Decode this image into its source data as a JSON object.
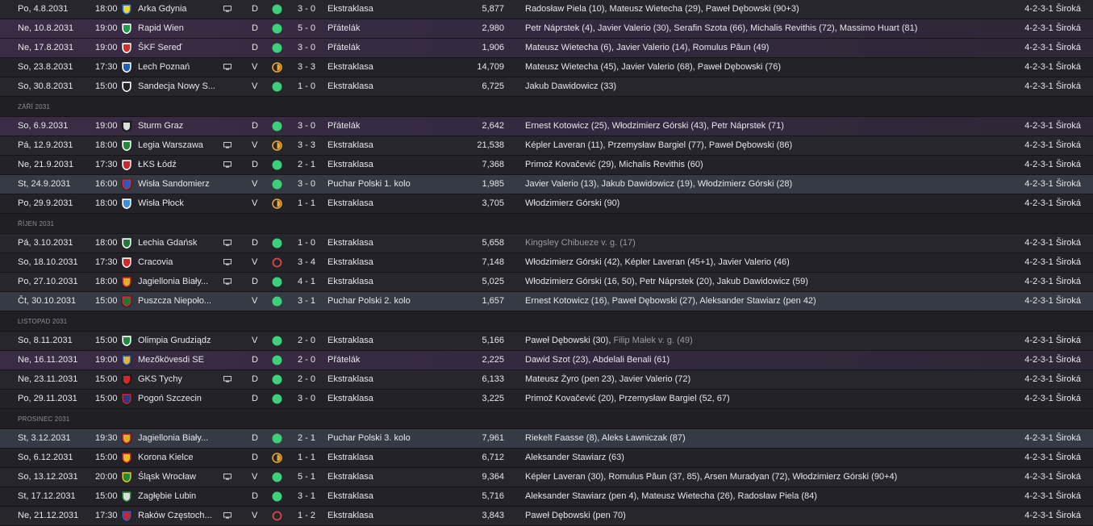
{
  "colors": {
    "win": "#3ecf7a",
    "draw": "#e7a532",
    "loss": "#d8474a",
    "friendly_row": "#3a2c44",
    "cup_row": "#363a45"
  },
  "groups": [
    {
      "month": "",
      "matches": [
        {
          "date": "Po, 4.8.2031",
          "time": "18:00",
          "crest": "arka-gdynia-crest",
          "crest_colors": [
            "#f2d431",
            "#2a6fc9"
          ],
          "opponent": "Arka Gdynia",
          "tv": true,
          "venue": "D",
          "result": "win",
          "score": "3 - 0",
          "competition": "Ekstraklasa",
          "type": "league",
          "attendance": "5,877",
          "scorers": [
            {
              "text": "Radosław Piela (10), Mateusz Wietecha (29), Paweł Dębowski (90+3)",
              "muted": false
            }
          ],
          "formation": "4-2-3-1 Široká"
        },
        {
          "date": "Ne, 10.8.2031",
          "time": "19:00",
          "crest": "rapid-wien-crest",
          "crest_colors": [
            "#1e9e4a",
            "#ffffff"
          ],
          "opponent": "Rapid Wien",
          "tv": false,
          "venue": "D",
          "result": "win",
          "score": "5 - 0",
          "competition": "Přátelák",
          "type": "friendly",
          "attendance": "2,980",
          "scorers": [
            {
              "text": "Petr Náprstek (4), Javier Valerio (30), Serafin Szota (66), Michalis Revithis (72), Massimo Huart (81)",
              "muted": false
            }
          ],
          "formation": "4-2-3-1 Široká"
        },
        {
          "date": "Ne, 17.8.2031",
          "time": "19:00",
          "crest": "skf-sered-crest",
          "crest_colors": [
            "#d22c2c",
            "#ffffff"
          ],
          "opponent": "ŠKF Sereď",
          "tv": false,
          "venue": "D",
          "result": "win",
          "score": "3 - 0",
          "competition": "Přátelák",
          "type": "friendly",
          "attendance": "1,906",
          "scorers": [
            {
              "text": "Mateusz Wietecha (6), Javier Valerio (14), Romulus Păun (49)",
              "muted": false
            }
          ],
          "formation": "4-2-3-1 Široká"
        },
        {
          "date": "So, 23.8.2031",
          "time": "17:30",
          "crest": "lech-poznan-crest",
          "crest_colors": [
            "#1f5fb8",
            "#ffffff"
          ],
          "opponent": "Lech Poznań",
          "tv": true,
          "venue": "V",
          "result": "draw",
          "score": "3 - 3",
          "competition": "Ekstraklasa",
          "type": "league",
          "attendance": "14,709",
          "scorers": [
            {
              "text": "Mateusz Wietecha (45), Javier Valerio (68), Paweł Dębowski (76)",
              "muted": false
            }
          ],
          "formation": "4-2-3-1 Široká"
        },
        {
          "date": "So, 30.8.2031",
          "time": "15:00",
          "crest": "sandecja-crest",
          "crest_colors": [
            "#222222",
            "#ffffff"
          ],
          "opponent": "Sandecja Nowy S...",
          "tv": false,
          "venue": "V",
          "result": "win",
          "score": "1 - 0",
          "competition": "Ekstraklasa",
          "type": "league",
          "attendance": "6,725",
          "scorers": [
            {
              "text": "Jakub Dawidowicz (33)",
              "muted": false
            }
          ],
          "formation": "4-2-3-1 Široká"
        }
      ]
    },
    {
      "month": "ZÁŘÍ 2031",
      "matches": [
        {
          "date": "So, 6.9.2031",
          "time": "19:00",
          "crest": "sturm-graz-crest",
          "crest_colors": [
            "#dddddd",
            "#222222"
          ],
          "opponent": "Sturm Graz",
          "tv": false,
          "venue": "D",
          "result": "win",
          "score": "3 - 0",
          "competition": "Přátelák",
          "type": "friendly",
          "attendance": "2,642",
          "scorers": [
            {
              "text": "Ernest Kotowicz (25), Włodzimierz Górski (43), Petr Náprstek (71)",
              "muted": false
            }
          ],
          "formation": "4-2-3-1 Široká"
        },
        {
          "date": "Pá, 12.9.2031",
          "time": "18:00",
          "crest": "legia-warszawa-crest",
          "crest_colors": [
            "#1d8a3c",
            "#ffffff"
          ],
          "opponent": "Legia Warszawa",
          "tv": true,
          "venue": "V",
          "result": "draw",
          "score": "3 - 3",
          "competition": "Ekstraklasa",
          "type": "league",
          "attendance": "21,538",
          "scorers": [
            {
              "text": "Képler Laveran (11), Przemysław Bargiel (77), Paweł Dębowski (86)",
              "muted": false
            }
          ],
          "formation": "4-2-3-1 Široká"
        },
        {
          "date": "Ne, 21.9.2031",
          "time": "17:30",
          "crest": "lks-lodz-crest",
          "crest_colors": [
            "#c8262b",
            "#ffffff"
          ],
          "opponent": "ŁKS Łódź",
          "tv": true,
          "venue": "D",
          "result": "win",
          "score": "2 - 1",
          "competition": "Ekstraklasa",
          "type": "league",
          "attendance": "7,368",
          "scorers": [
            {
              "text": "Primož Kovačević (29), Michalis Revithis (60)",
              "muted": false
            }
          ],
          "formation": "4-2-3-1 Široká"
        },
        {
          "date": "St, 24.9.2031",
          "time": "16:00",
          "crest": "wisla-sandomierz-crest",
          "crest_colors": [
            "#2a59c4",
            "#d82a2a"
          ],
          "opponent": "Wisła Sandomierz",
          "tv": false,
          "venue": "V",
          "result": "win",
          "score": "3 - 0",
          "competition": "Puchar Polski 1. kolo",
          "type": "cup",
          "attendance": "1,985",
          "scorers": [
            {
              "text": "Javier Valerio (13), Jakub Dawidowicz (19), Włodzimierz Górski (28)",
              "muted": false
            }
          ],
          "formation": "4-2-3-1 Široká"
        },
        {
          "date": "Po, 29.9.2031",
          "time": "18:00",
          "crest": "wisla-plock-crest",
          "crest_colors": [
            "#3b8ee0",
            "#ffffff"
          ],
          "opponent": "Wisła Płock",
          "tv": false,
          "venue": "V",
          "result": "draw",
          "score": "1 - 1",
          "competition": "Ekstraklasa",
          "type": "league",
          "attendance": "3,705",
          "scorers": [
            {
              "text": "Włodzimierz Górski (90)",
              "muted": false
            }
          ],
          "formation": "4-2-3-1 Široká"
        }
      ]
    },
    {
      "month": "ŘÍJEN 2031",
      "matches": [
        {
          "date": "Pá, 3.10.2031",
          "time": "18:00",
          "crest": "lechia-gdansk-crest",
          "crest_colors": [
            "#1f7a3a",
            "#ffffff"
          ],
          "opponent": "Lechia Gdańsk",
          "tv": true,
          "venue": "D",
          "result": "win",
          "score": "1 - 0",
          "competition": "Ekstraklasa",
          "type": "league",
          "attendance": "5,658",
          "scorers": [
            {
              "text": "Kingsley Chibueze v. g. (17)",
              "muted": true
            }
          ],
          "formation": "4-2-3-1 Široká"
        },
        {
          "date": "So, 18.10.2031",
          "time": "17:30",
          "crest": "cracovia-crest",
          "crest_colors": [
            "#d8262b",
            "#ffffff"
          ],
          "opponent": "Cracovia",
          "tv": true,
          "venue": "V",
          "result": "loss",
          "score": "3 - 4",
          "competition": "Ekstraklasa",
          "type": "league",
          "attendance": "7,148",
          "scorers": [
            {
              "text": "Włodzimierz Górski (42), Képler Laveran (45+1), Javier Valerio (46)",
              "muted": false
            }
          ],
          "formation": "4-2-3-1 Široká"
        },
        {
          "date": "Po, 27.10.2031",
          "time": "18:00",
          "crest": "jagiellonia-crest",
          "crest_colors": [
            "#d6b426",
            "#c8262b"
          ],
          "opponent": "Jagiellonia Biały...",
          "tv": true,
          "venue": "D",
          "result": "win",
          "score": "4 - 1",
          "competition": "Ekstraklasa",
          "type": "league",
          "attendance": "5,025",
          "scorers": [
            {
              "text": "Włodzimierz Górski (16, 50), Petr Náprstek (20), Jakub Dawidowicz (59)",
              "muted": false
            }
          ],
          "formation": "4-2-3-1 Široká"
        },
        {
          "date": "Čt, 30.10.2031",
          "time": "15:00",
          "crest": "puszcza-crest",
          "crest_colors": [
            "#1b7d35",
            "#d8262b"
          ],
          "opponent": "Puszcza Niepoło...",
          "tv": false,
          "venue": "V",
          "result": "win",
          "score": "3 - 1",
          "competition": "Puchar Polski 2. kolo",
          "type": "cup",
          "attendance": "1,657",
          "scorers": [
            {
              "text": "Ernest Kotowicz (16), Paweł Dębowski (27), Aleksander Stawiarz (pen 42)",
              "muted": false
            }
          ],
          "formation": "4-2-3-1 Široká"
        }
      ]
    },
    {
      "month": "LISTOPAD 2031",
      "matches": [
        {
          "date": "So, 8.11.2031",
          "time": "15:00",
          "crest": "olimpia-grudziadz-crest",
          "crest_colors": [
            "#1f8a3c",
            "#ffffff"
          ],
          "opponent": "Olimpia Grudziądz",
          "tv": false,
          "venue": "V",
          "result": "win",
          "score": "2 - 0",
          "competition": "Ekstraklasa",
          "type": "league",
          "attendance": "5,166",
          "scorers": [
            {
              "text": "Paweł Dębowski (30), ",
              "muted": false
            },
            {
              "text": "Filip Małek v. g. (49)",
              "muted": true
            }
          ],
          "formation": "4-2-3-1 Široká"
        },
        {
          "date": "Ne, 16.11.2031",
          "time": "19:00",
          "crest": "mezokovesd-crest",
          "crest_colors": [
            "#e3b52a",
            "#2a59c4"
          ],
          "opponent": "Mezőkövesdi SE",
          "tv": false,
          "venue": "D",
          "result": "win",
          "score": "2 - 0",
          "competition": "Přátelák",
          "type": "friendly",
          "attendance": "2,225",
          "scorers": [
            {
              "text": "Dawid Szot (23), Abdelali Benali (61)",
              "muted": false
            }
          ],
          "formation": "4-2-3-1 Široká"
        },
        {
          "date": "Ne, 23.11.2031",
          "time": "15:00",
          "crest": "gks-tychy-crest",
          "crest_colors": [
            "#d8262b",
            "#222222"
          ],
          "opponent": "GKS Tychy",
          "tv": true,
          "venue": "D",
          "result": "win",
          "score": "2 - 0",
          "competition": "Ekstraklasa",
          "type": "league",
          "attendance": "6,133",
          "scorers": [
            {
              "text": "Mateusz Żyro (pen 23), Javier Valerio (72)",
              "muted": false
            }
          ],
          "formation": "4-2-3-1 Široká"
        },
        {
          "date": "Po, 29.11.2031",
          "time": "15:00",
          "crest": "pogon-szczecin-crest",
          "crest_colors": [
            "#1d3f8a",
            "#c8262b"
          ],
          "opponent": "Pogoń Szczecin",
          "tv": false,
          "venue": "D",
          "result": "win",
          "score": "3 - 0",
          "competition": "Ekstraklasa",
          "type": "league",
          "attendance": "3,225",
          "scorers": [
            {
              "text": "Primož Kovačević (20), Przemysław Bargiel (52, 67)",
              "muted": false
            }
          ],
          "formation": "4-2-3-1 Široká"
        }
      ]
    },
    {
      "month": "PROSINEC 2031",
      "matches": [
        {
          "date": "St, 3.12.2031",
          "time": "19:30",
          "crest": "jagiellonia-crest",
          "crest_colors": [
            "#d6b426",
            "#c8262b"
          ],
          "opponent": "Jagiellonia Biały...",
          "tv": false,
          "venue": "D",
          "result": "win",
          "score": "2 - 1",
          "competition": "Puchar Polski 3. kolo",
          "type": "cup",
          "attendance": "7,961",
          "scorers": [
            {
              "text": "Riekelt Faasse (8), Aleks Ławniczak (87)",
              "muted": false
            }
          ],
          "formation": "4-2-3-1 Široká"
        },
        {
          "date": "So, 6.12.2031",
          "time": "15:00",
          "crest": "korona-kielce-crest",
          "crest_colors": [
            "#e3c01f",
            "#c8262b"
          ],
          "opponent": "Korona Kielce",
          "tv": false,
          "venue": "D",
          "result": "draw",
          "score": "1 - 1",
          "competition": "Ekstraklasa",
          "type": "league",
          "attendance": "6,712",
          "scorers": [
            {
              "text": "Aleksander Stawiarz (63)",
              "muted": false
            }
          ],
          "formation": "4-2-3-1 Široká"
        },
        {
          "date": "So, 13.12.2031",
          "time": "20:00",
          "crest": "slask-wroclaw-crest",
          "crest_colors": [
            "#1d8a3c",
            "#e3c01f"
          ],
          "opponent": "Śląsk Wrocław",
          "tv": true,
          "venue": "V",
          "result": "win",
          "score": "5 - 1",
          "competition": "Ekstraklasa",
          "type": "league",
          "attendance": "9,364",
          "scorers": [
            {
              "text": "Képler Laveran (30), Romulus Păun (37, 85), Arsen Muradyan (72), Włodzimierz Górski (90+4)",
              "muted": false
            }
          ],
          "formation": "4-2-3-1 Široká"
        },
        {
          "date": "St, 17.12.2031",
          "time": "15:00",
          "crest": "zaglebie-lubin-crest",
          "crest_colors": [
            "#dddddd",
            "#2a8a3c"
          ],
          "opponent": "Zagłębie Lubin",
          "tv": false,
          "venue": "D",
          "result": "win",
          "score": "3 - 1",
          "competition": "Ekstraklasa",
          "type": "league",
          "attendance": "5,716",
          "scorers": [
            {
              "text": "Aleksander Stawiarz (pen 4), Mateusz Wietecha (26), Radosław Piela (84)",
              "muted": false
            }
          ],
          "formation": "4-2-3-1 Široká"
        },
        {
          "date": "Ne, 21.12.2031",
          "time": "17:30",
          "crest": "rakow-crest",
          "crest_colors": [
            "#c8262b",
            "#2a59c4"
          ],
          "opponent": "Raków Częstoch...",
          "tv": true,
          "venue": "V",
          "result": "loss",
          "score": "1 - 2",
          "competition": "Ekstraklasa",
          "type": "league",
          "attendance": "3,843",
          "scorers": [
            {
              "text": "Paweł Dębowski (pen 70)",
              "muted": false
            }
          ],
          "formation": "4-2-3-1 Široká"
        }
      ]
    }
  ]
}
